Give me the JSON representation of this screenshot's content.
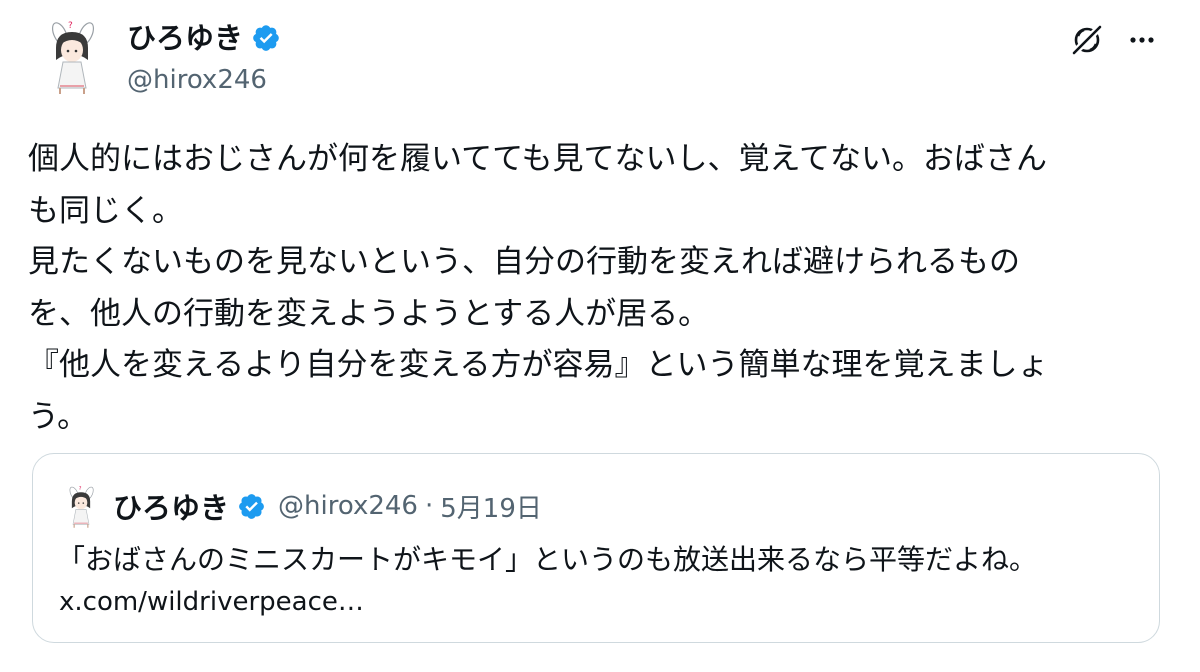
{
  "author": {
    "display_name": "ひろゆき",
    "handle": "@hirox246",
    "avatar_icon": "avatar-illustration",
    "verified_icon": "verified-badge-icon"
  },
  "actions": {
    "grok_icon": "grok-icon",
    "more_icon": "more-options-icon"
  },
  "tweet": {
    "lines": [
      "個人的にはおじさんが何を履いてても見てないし、覚えてない。おばさん",
      "も同じく。",
      "見たくないものを見ないという、自分の行動を変えれば避けられるもの",
      "を、他人の行動を変えようようとする人が居る。",
      "『他人を変えるより自分を変える方が容易』という簡単な理を覚えましょ",
      "う。"
    ]
  },
  "quote": {
    "display_name": "ひろゆき",
    "handle": "@hirox246",
    "separator": "·",
    "date": "5月19日",
    "text": "「おばさんのミニスカートがキモイ」というのも放送出来るなら平等だよね。",
    "link": "x.com/wildriverpeace…"
  },
  "colors": {
    "text": "#0f1419",
    "secondary": "#536471",
    "verified": "#1d9bf0",
    "border": "#cfd9de"
  }
}
